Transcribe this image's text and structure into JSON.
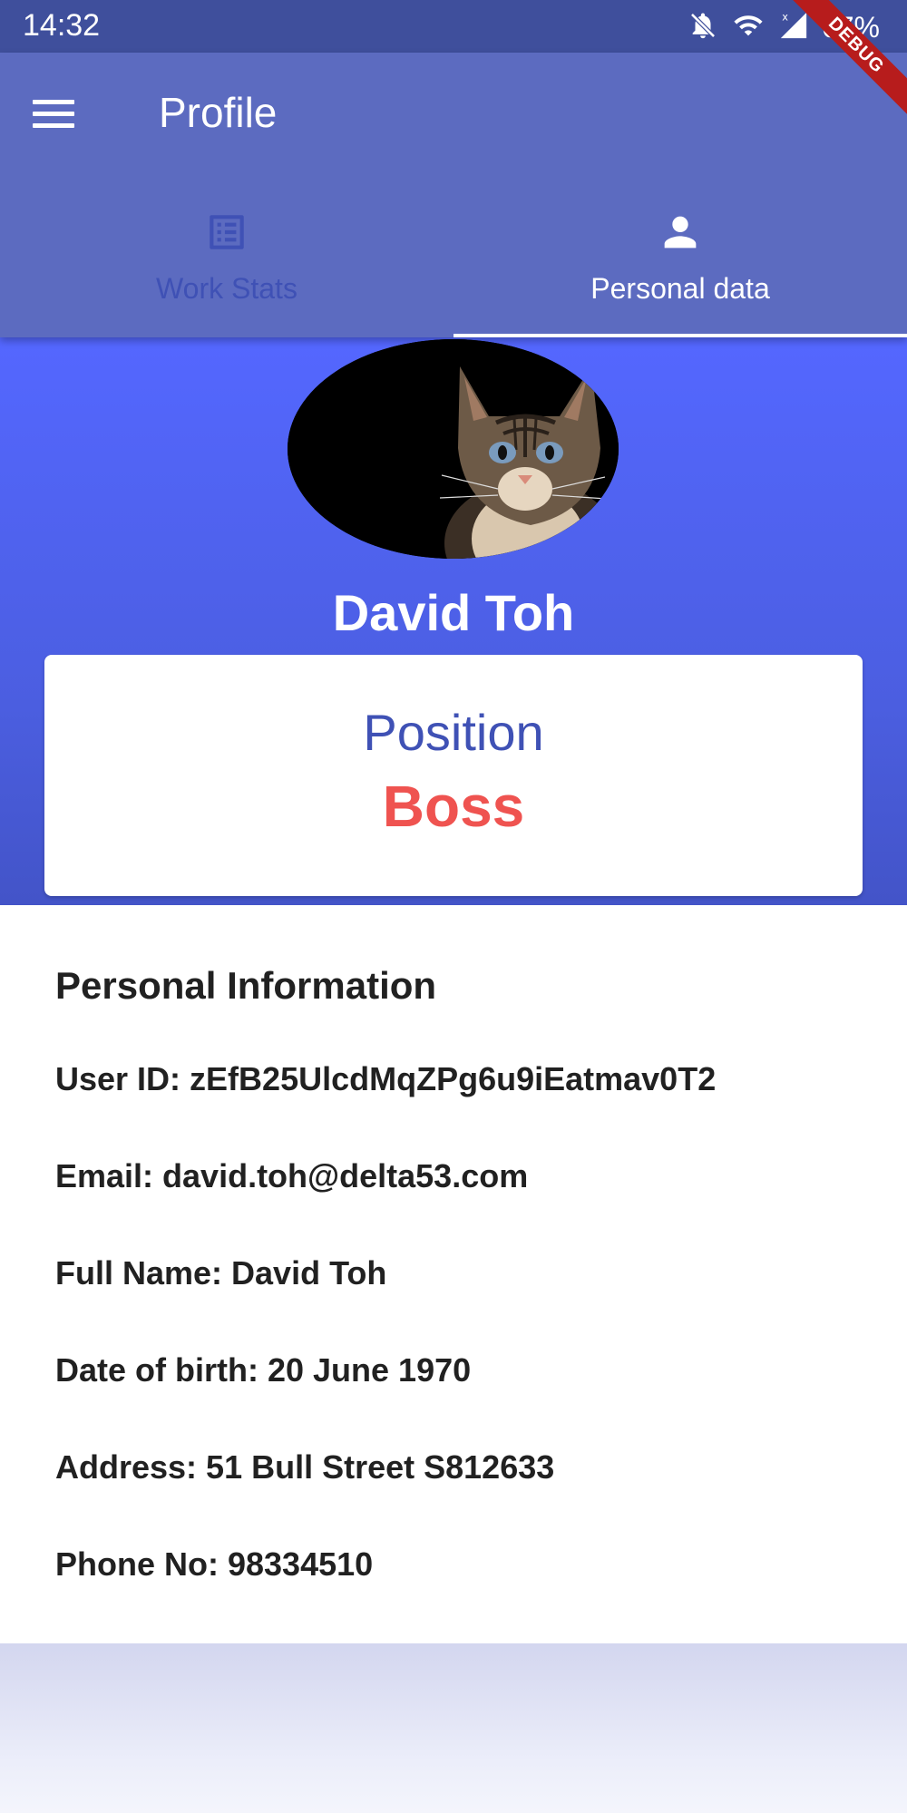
{
  "status_bar": {
    "time": "14:32",
    "battery": "67%",
    "icons": [
      "notifications-off-icon",
      "wifi-icon",
      "signal-icon"
    ]
  },
  "debug_banner": "DEBUG",
  "app_bar": {
    "title": "Profile",
    "menu_icon": "menu-icon",
    "background": "#5c6bc0"
  },
  "tabs": [
    {
      "label": "Work Stats",
      "icon": "list-icon",
      "active": false
    },
    {
      "label": "Personal data",
      "icon": "person-icon",
      "active": true
    }
  ],
  "profile": {
    "name": "David Toh",
    "avatar": "cat-photo",
    "position_label": "Position",
    "position_value": "Boss"
  },
  "personal_info": {
    "title": "Personal Information",
    "rows": [
      "User ID: zEfB25UlcdMqZPg6u9iEatmav0T2",
      "Email: david.toh@delta53.com",
      "Full Name: David Toh",
      "Date of birth: 20 June 1970",
      "Address: 51 Bull Street S812633",
      "Phone No: 98334510"
    ]
  },
  "colors": {
    "accent": "#3f51b5",
    "header_gradient_top": "#5467ff",
    "position_value": "#ef5350"
  }
}
